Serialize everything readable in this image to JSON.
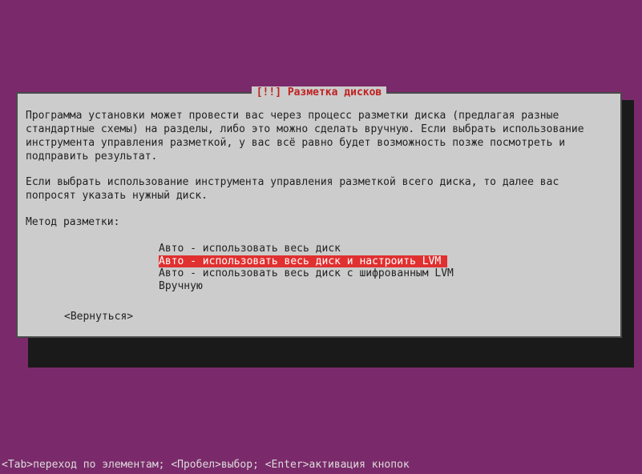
{
  "dialog": {
    "title": "[!!] Разметка дисков",
    "paragraph1": "Программа установки может провести вас через процесс разметки диска (предлагая разные стандартные схемы) на разделы, либо это можно сделать вручную. Если выбрать использование инструмента управления разметкой, у вас всё равно будет возможность позже посмотреть и подправить результат.",
    "paragraph2": "Если выбрать использование инструмента управления разметкой всего диска, то далее вас попросят указать нужный диск.",
    "prompt": "Метод разметки:",
    "options": [
      "Авто - использовать весь диск",
      "Авто - использовать весь диск и настроить LVM",
      "Авто - использовать весь диск с шифрованным LVM",
      "Вручную"
    ],
    "selected_index": 1,
    "back": "<Вернуться>"
  },
  "statusbar": "<Tab>переход по элементам; <Пробел>выбор; <Enter>активация кнопок"
}
